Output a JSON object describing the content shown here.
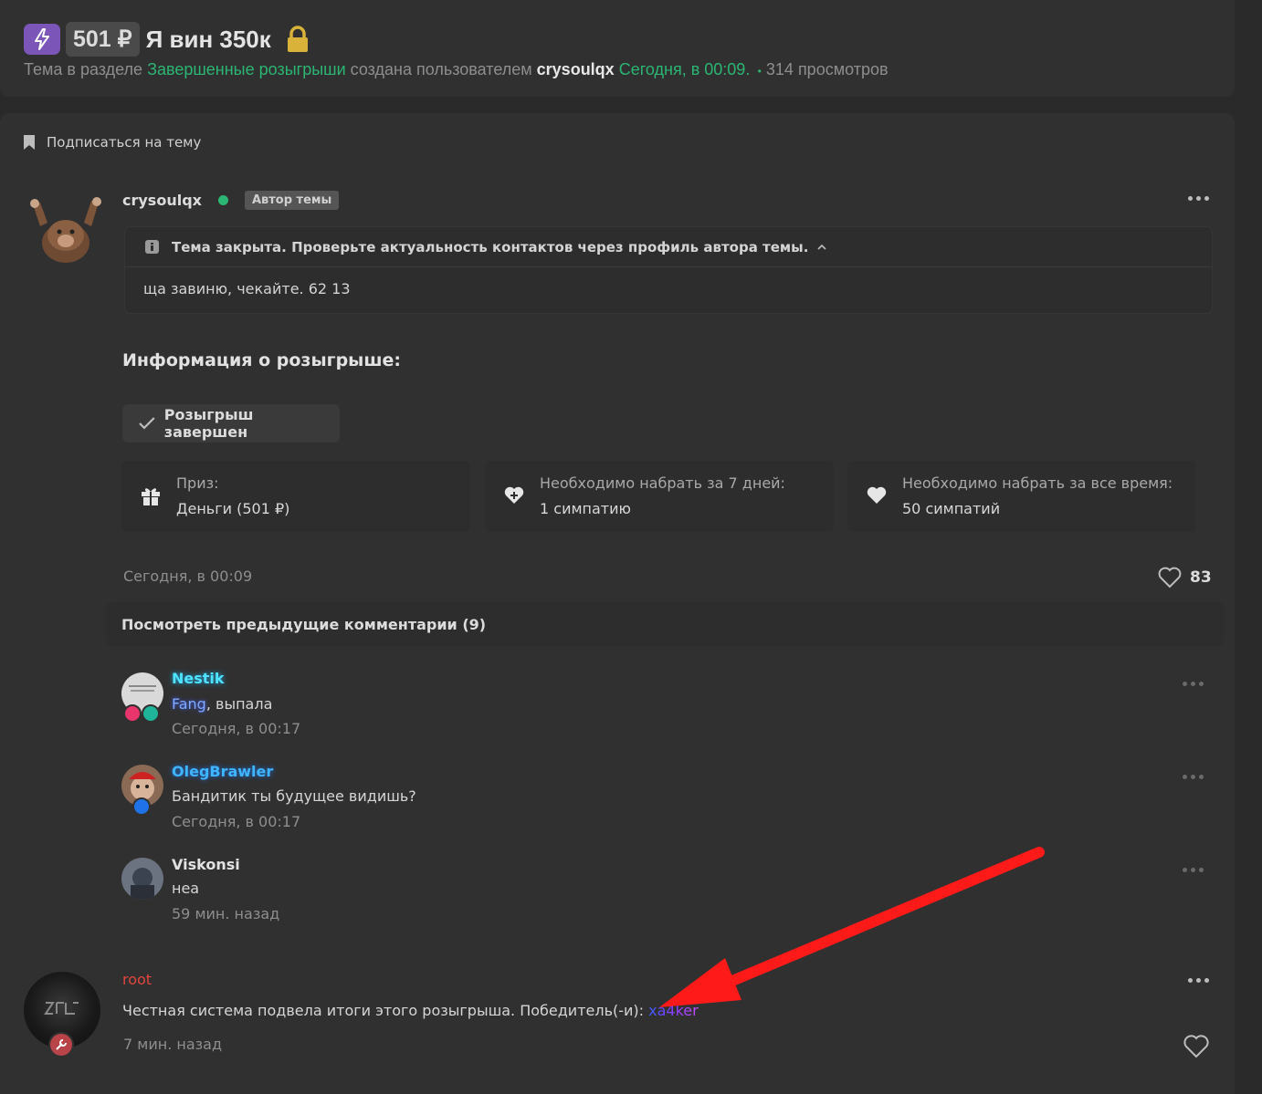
{
  "header": {
    "price": "501 ₽",
    "title": "Я вин 350к",
    "meta_prefix": "Тема в разделе",
    "section": "Завершенные розыгрыши",
    "created_by": "создана пользователем",
    "author": "crysoulqx",
    "created_time": "Сегодня, в 00:09.",
    "views": "314 просмотров"
  },
  "subscribe_label": "Подписаться на тему",
  "post": {
    "username": "crysoulqx",
    "badge": "Автор темы",
    "closed_notice": "Тема закрыта. Проверьте актуальность контактов через профиль автора темы.",
    "body": "ща завиню, чекайте. 62 13",
    "giveaway_title": "Информация о розыгрыше:",
    "finished_label": "Розыгрыш завершен",
    "stats": [
      {
        "label": "Приз:",
        "value": "Деньги (501 ₽)",
        "icon": "gift-icon"
      },
      {
        "label": "Необходимо набрать за 7 дней:",
        "value": "1 симпатию",
        "icon": "heart-plus-icon"
      },
      {
        "label": "Необходимо набрать за все время:",
        "value": "50 симпатий",
        "icon": "heart-icon"
      }
    ],
    "date": "Сегодня, в 00:09",
    "likes": "83"
  },
  "prev_comments_label": "Посмотреть предыдущие комментарии (9)",
  "comments": [
    {
      "name": "Nestik",
      "mention": "Fang",
      "text": ", выпала",
      "time": "Сегодня, в 00:17"
    },
    {
      "name": "OlegBrawler",
      "text": "Бандитик ты будущее видишь?",
      "time": "Сегодня, в 00:17"
    },
    {
      "name": "Viskonsi",
      "text": "неа",
      "time": "59 мин. назад"
    }
  ],
  "reply": {
    "name": "root",
    "text": "Честная система подвела итоги этого розыгрыша. Победитель(-и): ",
    "winner": "xa4ker",
    "time": "7 мин. назад"
  },
  "colors": {
    "accent_green": "#2bb673",
    "purple_badge": "#7b55b8",
    "root_red": "#e0463c",
    "arrow_red": "#ff1a1a"
  }
}
